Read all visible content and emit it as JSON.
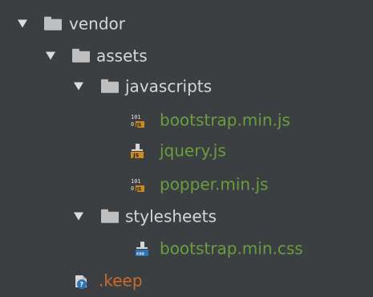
{
  "tree": {
    "vendor": {
      "label": "vendor"
    },
    "assets": {
      "label": "assets"
    },
    "javascripts": {
      "label": "javascripts"
    },
    "bootstrap_js": {
      "label": "bootstrap.min.js"
    },
    "jquery_js": {
      "label": "jquery.js"
    },
    "popper_js": {
      "label": "popper.min.js"
    },
    "stylesheets": {
      "label": "stylesheets"
    },
    "bootstrap_css": {
      "label": "bootstrap.min.css"
    },
    "keep": {
      "label": ".keep"
    }
  },
  "colors": {
    "background": "#3c3f41",
    "folder_text": "#d7d7d7",
    "file_text": "#6a9d3e",
    "keep_text": "#cc6a2c",
    "folder_icon": "#bfbfbf",
    "js_badge": "#cc8a21",
    "css_badge": "#2e74b5"
  },
  "icons": {
    "collapse_arrow": "chevron-down-icon",
    "folder": "folder-icon",
    "js_binary_file": "js-binary-file-icon",
    "js_file": "js-file-icon",
    "css_file": "css-file-icon",
    "keep_file": "unknown-file-icon"
  }
}
